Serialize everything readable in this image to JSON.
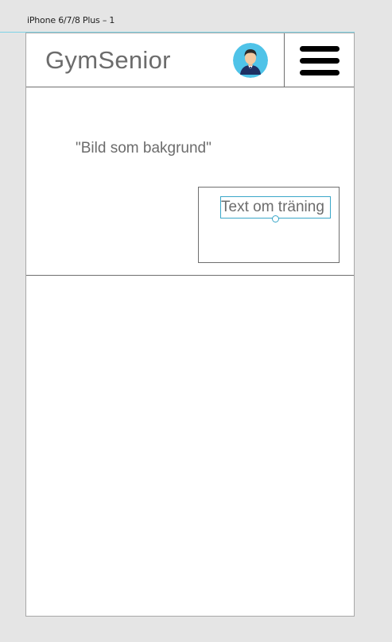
{
  "artboard": {
    "label": "iPhone 6/7/8 Plus – 1"
  },
  "header": {
    "brand": "GymSenior",
    "avatar_icon": "person-avatar-icon",
    "menu_icon": "hamburger-menu-icon"
  },
  "hero": {
    "placeholder": "\"Bild som bakgrund\"",
    "info_text": "Text om träning"
  },
  "colors": {
    "canvas": "#e5e5e5",
    "artboard": "#ffffff",
    "text_gray": "#6c6c6c",
    "selection": "#3aa7c9",
    "avatar_bg": "#4fc3e8"
  }
}
